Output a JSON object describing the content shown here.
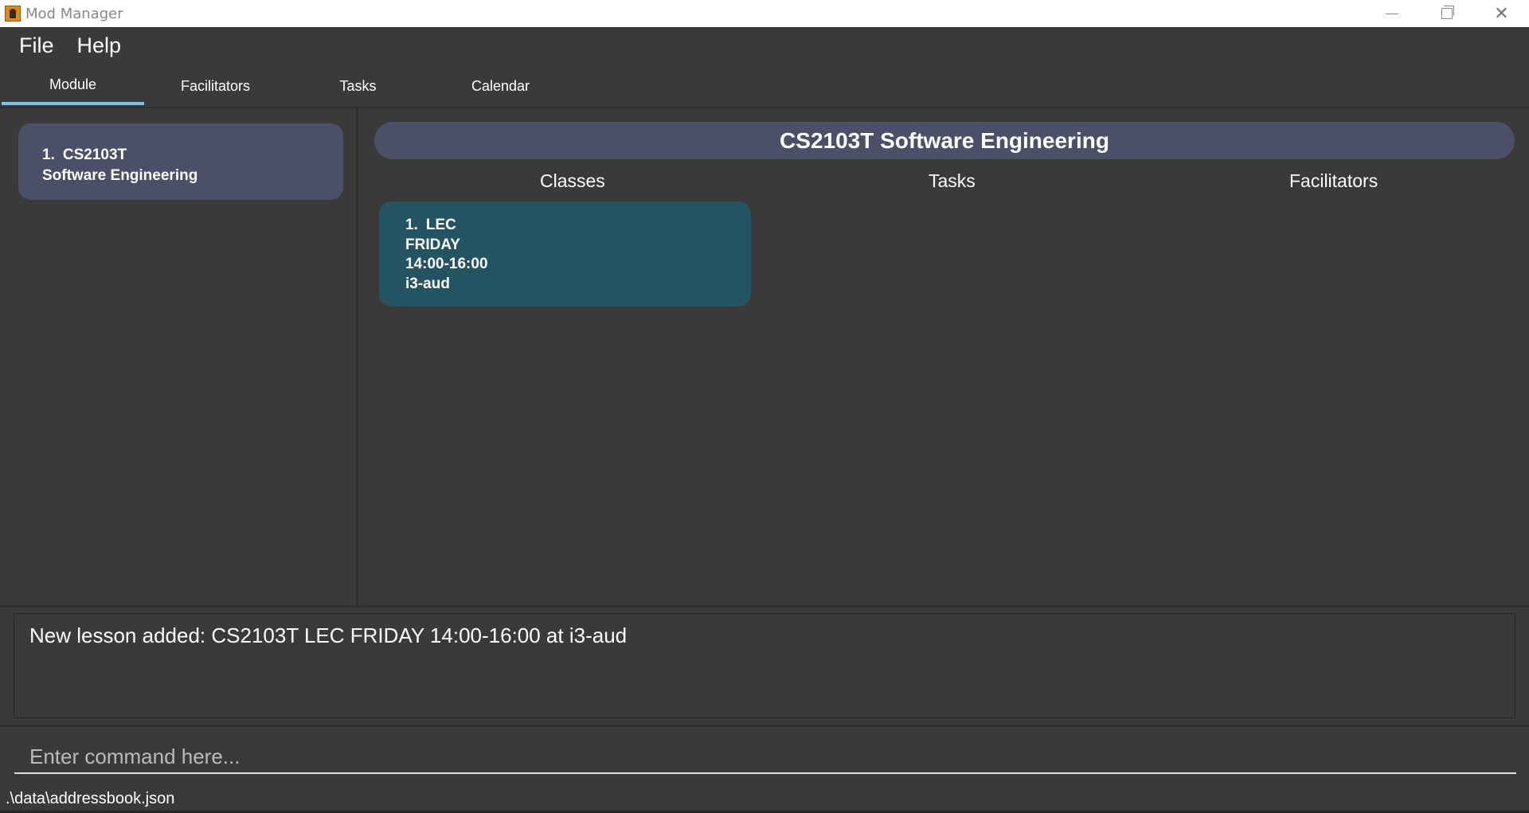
{
  "window": {
    "title": "Mod Manager"
  },
  "menu": {
    "file": "File",
    "help": "Help"
  },
  "tabs": [
    {
      "label": "Module",
      "active": true
    },
    {
      "label": "Facilitators",
      "active": false
    },
    {
      "label": "Tasks",
      "active": false
    },
    {
      "label": "Calendar",
      "active": false
    }
  ],
  "modules": [
    {
      "index": "1.",
      "code": "CS2103T",
      "name": "Software Engineering"
    }
  ],
  "detail": {
    "title": "CS2103T Software Engineering",
    "columns": {
      "classes": "Classes",
      "tasks": "Tasks",
      "facilitators": "Facilitators"
    },
    "lessons": [
      {
        "index": "1.",
        "type": "LEC",
        "day": "FRIDAY",
        "time": "14:00-16:00",
        "venue": "i3-aud"
      }
    ]
  },
  "result": {
    "text": "New lesson added: CS2103T LEC FRIDAY 14:00-16:00 at i3-aud"
  },
  "command": {
    "placeholder": "Enter command here...",
    "value": ""
  },
  "status": {
    "path": ".\\data\\addressbook.json"
  },
  "colors": {
    "background": "#3a3a3a",
    "card": "#4b5068",
    "lesson_card": "#245362",
    "tab_active": "#7fc0e8"
  }
}
